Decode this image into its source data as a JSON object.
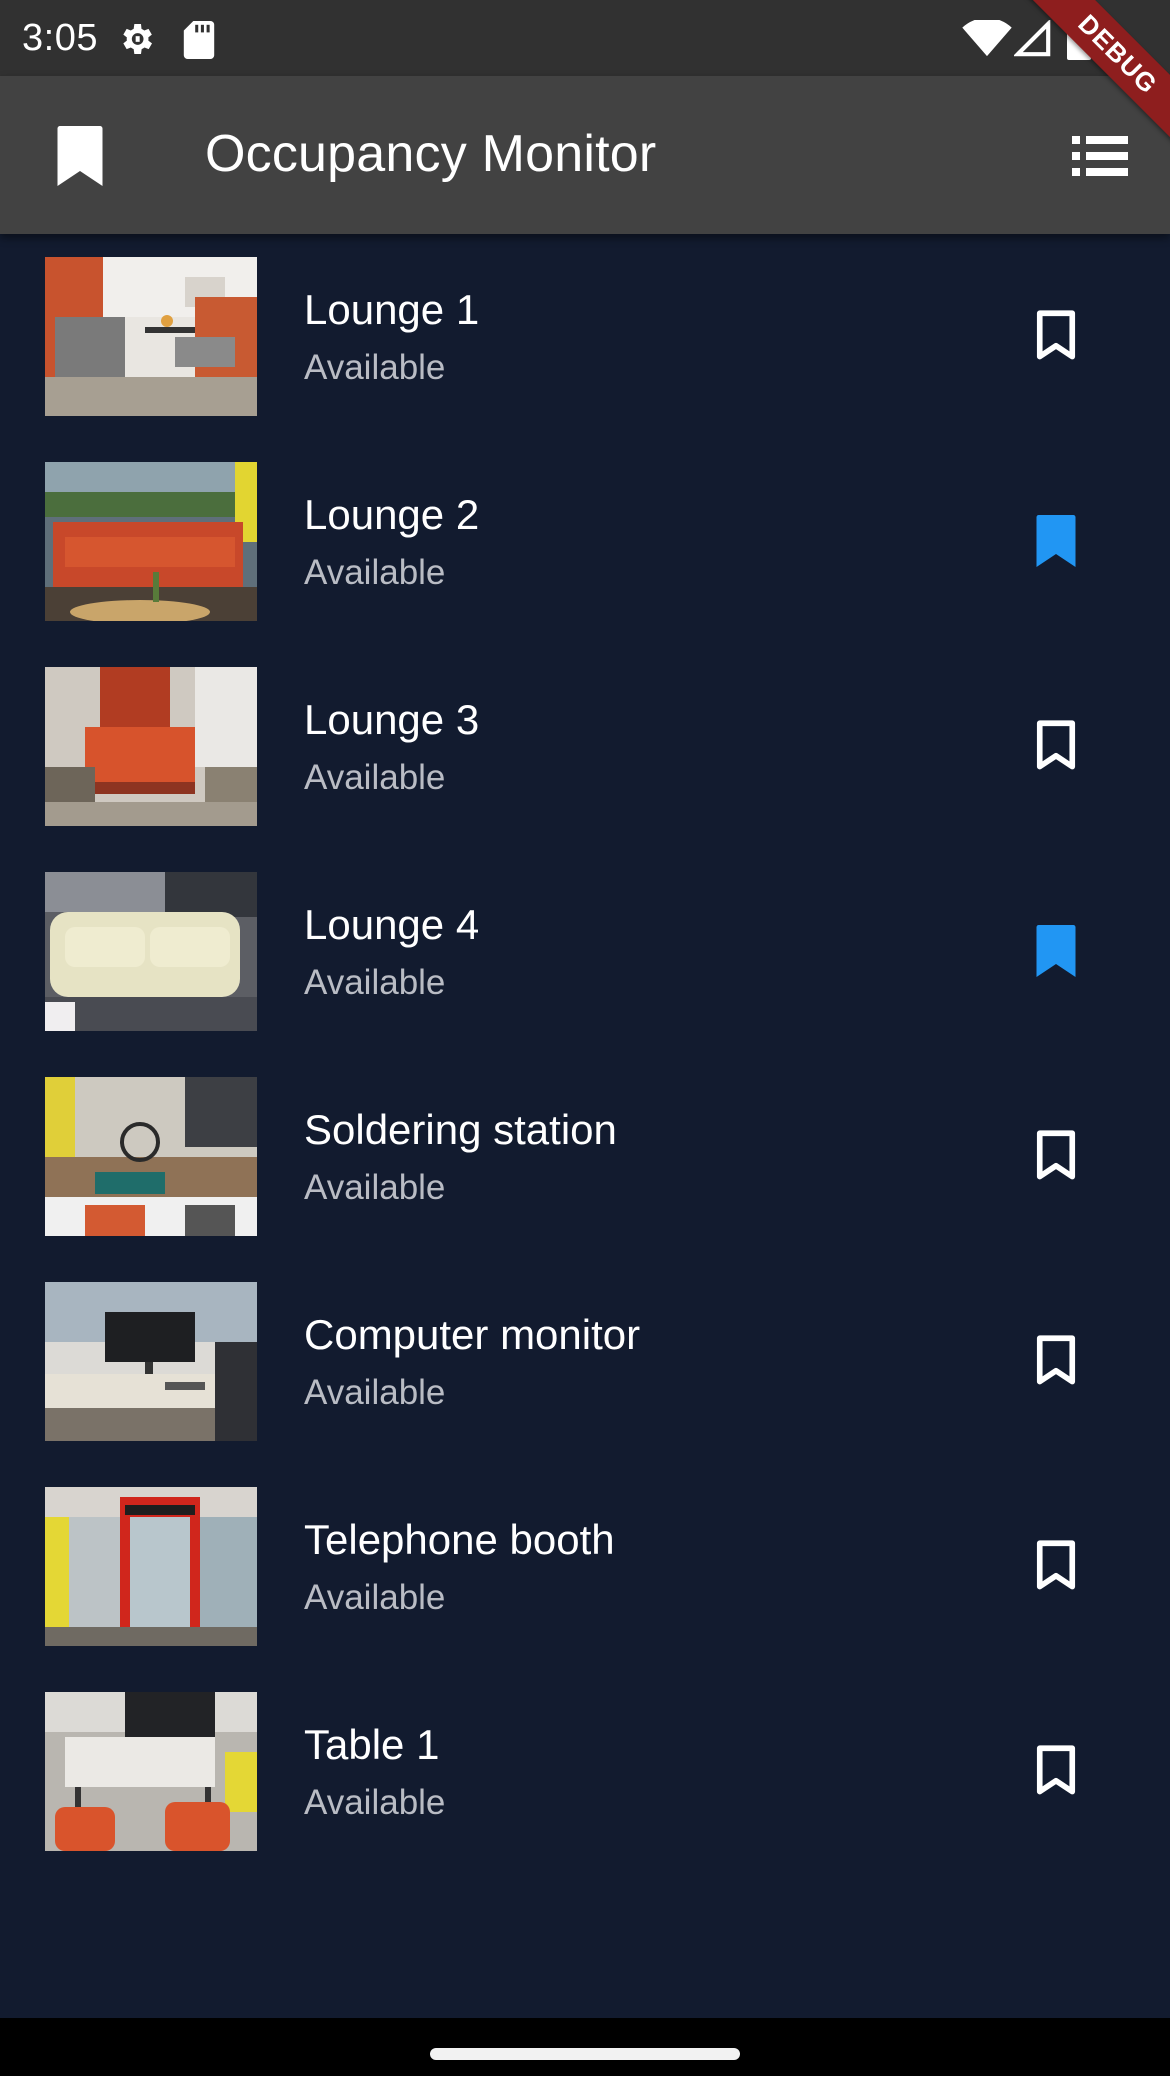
{
  "status_bar": {
    "time": "3:05",
    "icons": [
      "gear-icon",
      "sd-card-icon",
      "wifi-icon",
      "signal-icon",
      "battery-icon"
    ]
  },
  "app_bar": {
    "title": "Occupancy Monitor",
    "leading_icon": "bookmark-icon",
    "trailing_icon": "list-icon"
  },
  "debug_banner": "DEBUG",
  "colors": {
    "background": "#121b2f",
    "app_bar": "#424242",
    "bookmark_active": "#2196f3",
    "bookmark_inactive": "#ffffff",
    "status_text": "#b9bcc4"
  },
  "spaces": [
    {
      "name": "Lounge 1",
      "status": "Available",
      "bookmarked": false,
      "image": "lounge-booth-photo"
    },
    {
      "name": "Lounge 2",
      "status": "Available",
      "bookmarked": true,
      "image": "orange-sofa-photo"
    },
    {
      "name": "Lounge 3",
      "status": "Available",
      "bookmarked": false,
      "image": "orange-chair-photo"
    },
    {
      "name": "Lounge 4",
      "status": "Available",
      "bookmarked": true,
      "image": "beige-sofa-photo"
    },
    {
      "name": "Soldering station",
      "status": "Available",
      "bookmarked": false,
      "image": "workbench-photo"
    },
    {
      "name": "Computer monitor",
      "status": "Available",
      "bookmarked": false,
      "image": "desk-monitor-photo"
    },
    {
      "name": "Telephone booth",
      "status": "Available",
      "bookmarked": false,
      "image": "red-phone-booth-photo"
    },
    {
      "name": "Table 1",
      "status": "Available",
      "bookmarked": false,
      "image": "meeting-table-photo"
    }
  ]
}
